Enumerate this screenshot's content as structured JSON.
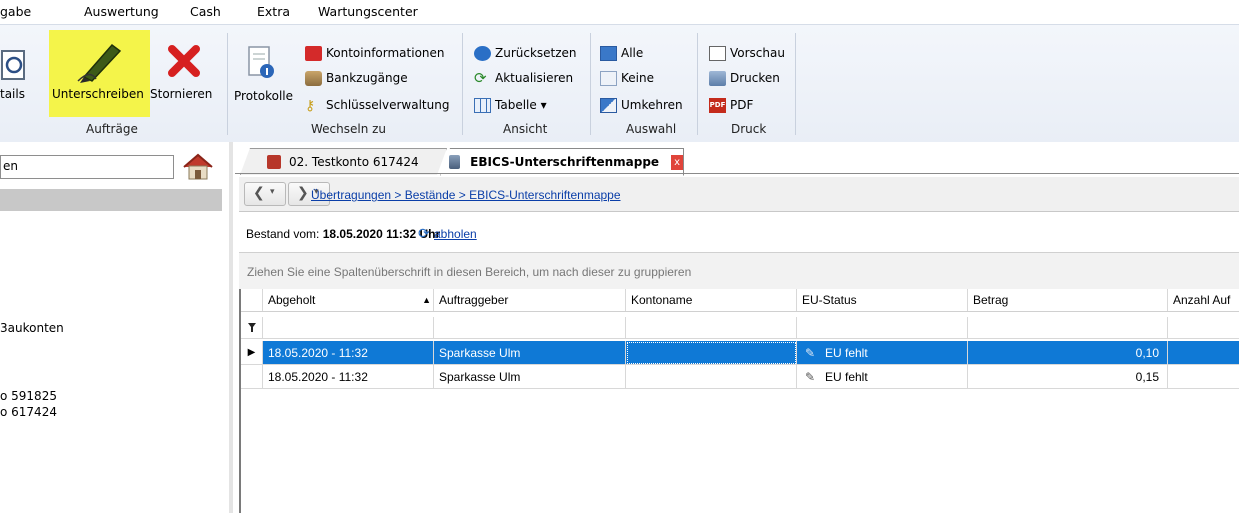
{
  "menu": [
    "gabe",
    "Auswertung",
    "Cash",
    "Extra",
    "Wartungscenter"
  ],
  "ribbon": {
    "auftraege": {
      "label": "Aufträge",
      "details": "tails",
      "unterschreiben": "Unterschreiben",
      "stornieren": "Stornieren"
    },
    "wechseln": {
      "label": "Wechseln zu",
      "protokolle": "Protokolle",
      "kontoinformationen": "Kontoinformationen",
      "bankzugaenge": "Bankzugänge",
      "schluessel": "Schlüsselverwaltung"
    },
    "ansicht": {
      "label": "Ansicht",
      "zuruecksetzen": "Zurücksetzen",
      "aktualisieren": "Aktualisieren",
      "tabelle": "Tabelle ▾"
    },
    "auswahl": {
      "label": "Auswahl",
      "alle": "Alle",
      "keine": "Keine",
      "umkehren": "Umkehren"
    },
    "druck": {
      "label": "Druck",
      "vorschau": "Vorschau",
      "drucken": "Drucken",
      "pdf": "PDF",
      "pdf_badge": "PDF"
    }
  },
  "left": {
    "search_value": "en",
    "items": [
      "3aukonten",
      "o 591825",
      "o 617424"
    ]
  },
  "tabs": [
    {
      "label": "02. Testkonto 617424"
    },
    {
      "label": "EBICS-Unterschriftenmappe",
      "close": "x"
    }
  ],
  "breadcrumb": "Übertragungen > Bestände > EBICS-Unterschriftenmappe",
  "bestand": {
    "label": "Bestand vom: ",
    "datetime": "18.05.2020 11:32 Uhr",
    "abholen": "abholen"
  },
  "group_hint": "Ziehen Sie eine Spaltenüberschrift in diesen Bereich, um nach dieser zu gruppieren",
  "grid": {
    "columns": [
      "Abgeholt",
      "Auftraggeber",
      "Kontoname",
      "EU-Status",
      "Betrag",
      "Anzahl Auf"
    ],
    "sort_indicator": "▲",
    "filter_icon": "filter-icon",
    "rows": [
      {
        "abgeholt": "18.05.2020 - 11:32",
        "auftraggeber": "Sparkasse Ulm",
        "kontoname": "",
        "status": "EU fehlt",
        "betrag": "0,10",
        "anzahl": "",
        "selected": true
      },
      {
        "abgeholt": "18.05.2020 - 11:32",
        "auftraggeber": "Sparkasse Ulm",
        "kontoname": "",
        "status": "EU fehlt",
        "betrag": "0,15",
        "anzahl": "",
        "selected": false
      }
    ]
  },
  "colors": {
    "selection": "#0f79d6",
    "highlight": "#f4f44a",
    "link": "#0a3ea8"
  }
}
